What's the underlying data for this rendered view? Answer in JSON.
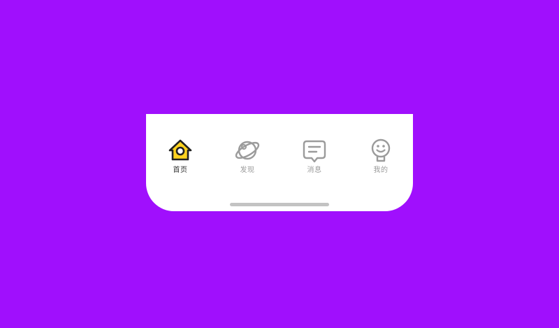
{
  "colors": {
    "background": "#a00ffd",
    "bar": "#ffffff",
    "active_icon_fill": "#ffd21f",
    "active_icon_stroke": "#222222",
    "inactive": "#9b9b9b",
    "active_label": "#333333",
    "home_indicator": "#c3c3c3"
  },
  "tabbar": {
    "active_index": 0,
    "tabs": [
      {
        "id": "home",
        "label": "首页",
        "icon": "home-icon"
      },
      {
        "id": "discover",
        "label": "发现",
        "icon": "planet-icon"
      },
      {
        "id": "messages",
        "label": "消息",
        "icon": "message-icon"
      },
      {
        "id": "me",
        "label": "我的",
        "icon": "smile-face-icon"
      }
    ]
  }
}
